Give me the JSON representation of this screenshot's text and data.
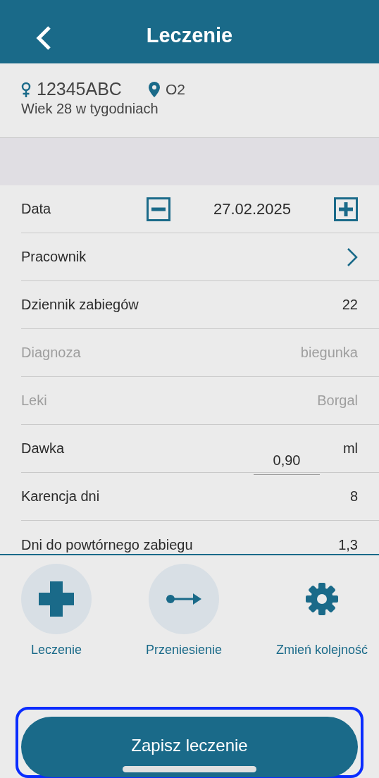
{
  "header": {
    "title": "Leczenie"
  },
  "animal": {
    "id": "12345ABC",
    "location": "O2",
    "age": "Wiek 28 w tygodniach"
  },
  "rows": [
    {
      "kind": "date",
      "label": "Data",
      "value": "27.02.2025",
      "disabled": false
    },
    {
      "kind": "link",
      "label": "Pracownik",
      "disabled": false
    },
    {
      "kind": "value",
      "label": "Dziennik zabiegów",
      "value": "22",
      "disabled": false
    },
    {
      "kind": "value",
      "label": "Diagnoza",
      "value": "biegunka",
      "disabled": true
    },
    {
      "kind": "value",
      "label": "Leki",
      "value": "Borgal",
      "disabled": true
    },
    {
      "kind": "input",
      "label": "Dawka",
      "value": "0,90",
      "unit": "ml",
      "disabled": false
    },
    {
      "kind": "value",
      "label": "Karencja dni",
      "value": "8",
      "disabled": false
    },
    {
      "kind": "value",
      "label": "Dni do powtórnego zabiegu",
      "value": "1,3",
      "disabled": false
    }
  ],
  "actions": [
    {
      "kind": "plus",
      "label": "Leczenie",
      "circle": true
    },
    {
      "kind": "arrow",
      "label": "Przeniesienie",
      "circle": true
    },
    {
      "kind": "gear",
      "label": "Zmień kolejność",
      "circle": false
    }
  ],
  "save_button": {
    "label": "Zapisz leczenie",
    "focused": true
  }
}
